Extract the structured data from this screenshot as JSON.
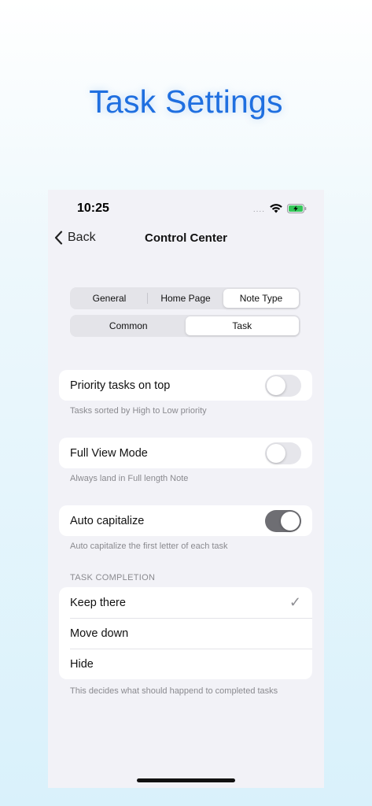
{
  "hero": {
    "title": "Task Settings"
  },
  "status": {
    "time": "10:25",
    "signal": "....",
    "wifi_icon": "wifi-icon",
    "battery_icon": "battery-charging-icon"
  },
  "nav": {
    "back_label": "Back",
    "title": "Control Center"
  },
  "segments_main": [
    "General",
    "Home Page",
    "Note Type"
  ],
  "segments_main_selected": "Note Type",
  "segments_sub": [
    "Common",
    "Task"
  ],
  "segments_sub_selected": "Task",
  "settings": [
    {
      "label": "Priority tasks on top",
      "on": false,
      "footnote": "Tasks sorted by High to Low priority"
    },
    {
      "label": "Full View Mode",
      "on": false,
      "footnote": "Always land in Full length Note"
    },
    {
      "label": "Auto capitalize",
      "on": true,
      "footnote": "Auto capitalize the first letter of each task"
    }
  ],
  "task_completion": {
    "header": "TASK COMPLETION",
    "options": [
      "Keep there",
      "Move down",
      "Hide"
    ],
    "selected": "Keep there",
    "footnote": "This decides what should happend to completed tasks"
  },
  "colors": {
    "accent": "#1f6fe0",
    "toggle_on": "#6e6e73",
    "battery": "#34c759"
  }
}
